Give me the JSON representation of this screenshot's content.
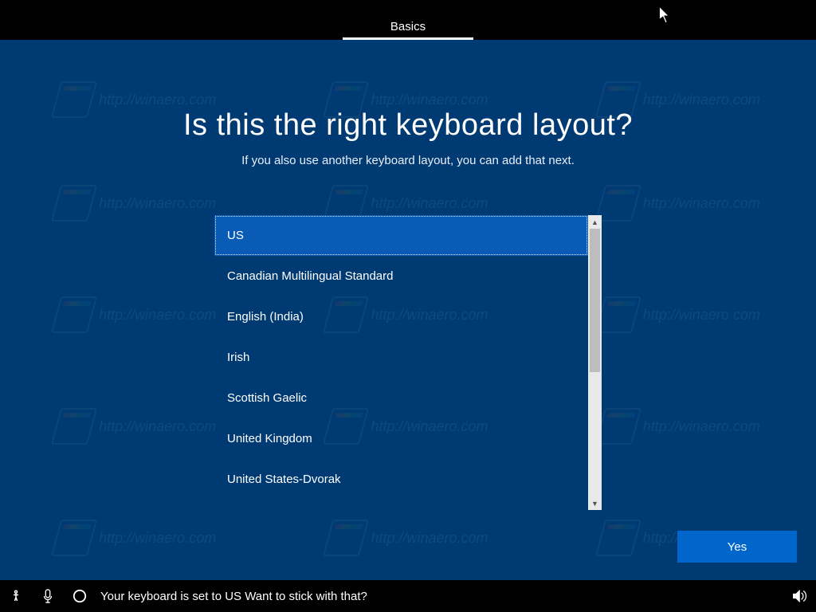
{
  "tab": {
    "label": "Basics"
  },
  "heading": {
    "title": "Is this the right keyboard layout?",
    "subtitle": "If you also use another keyboard layout, you can add that next."
  },
  "layouts": {
    "items": [
      "US",
      "Canadian Multilingual Standard",
      "English (India)",
      "Irish",
      "Scottish Gaelic",
      "United Kingdom",
      "United States-Dvorak"
    ],
    "selected_index": 0
  },
  "actions": {
    "yes": "Yes"
  },
  "taskbar": {
    "status": "Your keyboard is set to US Want to stick with that?"
  },
  "watermark": {
    "text": "http://winaero.com"
  }
}
